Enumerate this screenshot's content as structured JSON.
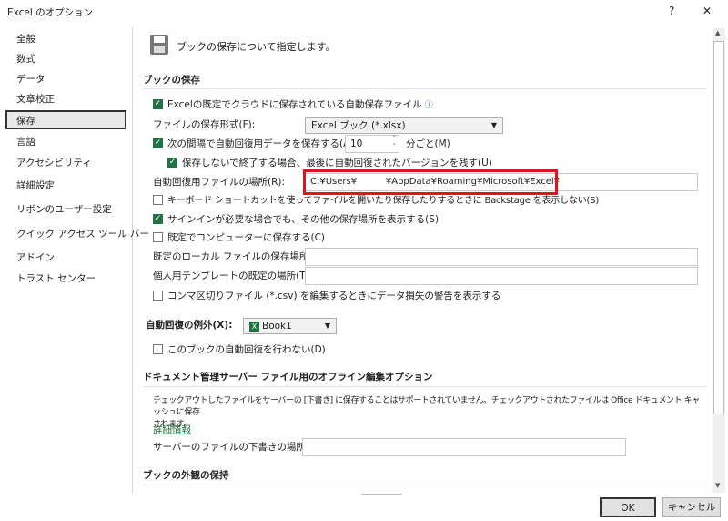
{
  "window": {
    "title": "Excel のオプション",
    "help": "?",
    "close": "✕"
  },
  "sidebar": {
    "items": [
      {
        "label": "全般"
      },
      {
        "label": "数式"
      },
      {
        "label": "データ"
      },
      {
        "label": "文章校正"
      },
      {
        "label": "保存"
      },
      {
        "label": "言語"
      },
      {
        "label": "アクセシビリティ"
      },
      {
        "label": "詳細設定"
      },
      {
        "label": "リボンのユーザー設定"
      },
      {
        "label": "クイック アクセス ツール バー"
      },
      {
        "label": "アドイン"
      },
      {
        "label": "トラスト センター"
      }
    ],
    "selected": 4
  },
  "header": {
    "title": "ブックの保存について指定します。"
  },
  "save": {
    "heading": "ブックの保存",
    "autosave_cloud": {
      "label": "Excelの既定でクラウドに保存されている自動保存ファイル",
      "checked": true
    },
    "format_label": "ファイルの保存形式(F):",
    "format_value": "Excel ブック (*.xlsx)",
    "autorecover": {
      "label": "次の間隔で自動回復用データを保存する(A):",
      "checked": true,
      "minutes": "10",
      "unit": "分ごと(M)"
    },
    "keep_last": {
      "label": "保存しないで終了する場合、最後に自動回復されたバージョンを残す(U)",
      "checked": true
    },
    "location_label": "自動回復用ファイルの場所(R):",
    "location_value": "C:¥Users¥          ¥AppData¥Roaming¥Microsoft¥Excel¥",
    "no_backstage": {
      "label": "キーボード ショートカットを使ってファイルを開いたり保存したりするときに Backstage を表示しない(S)",
      "checked": false
    },
    "show_other": {
      "label": "サインインが必要な場合でも、その他の保存場所を表示する(S)",
      "checked": true
    },
    "save_computer": {
      "label": "既定でコンピューターに保存する(C)",
      "checked": false
    },
    "local_label": "既定のローカル ファイルの保存場所(I):",
    "local_value": "",
    "template_label": "個人用テンプレートの既定の場所(T):",
    "template_value": "",
    "csv_warn": {
      "label": "コンマ区切りファイル (*.csv) を編集するときにデータ損失の警告を表示する",
      "checked": false
    }
  },
  "exceptions": {
    "label": "自動回復の例外(X):",
    "book": "Book1",
    "disable": {
      "label": "このブックの自動回復を行わない(D)",
      "checked": false
    }
  },
  "offline": {
    "heading": "ドキュメント管理サーバー ファイル用のオフライン編集オプション",
    "note": "チェックアウトしたファイルをサーバーの [下書き] に保存することはサポートされていません。チェックアウトされたファイルは Office ドキュメント キャッシュに保存",
    "note2": "されます。",
    "link": "詳細情報",
    "drafts_label": "サーバーのファイルの下書きの場所(V):",
    "drafts_value": ""
  },
  "appearance": {
    "heading": "ブックの外観の保持"
  },
  "footer": {
    "ok": "OK",
    "cancel": "キャンセル"
  }
}
